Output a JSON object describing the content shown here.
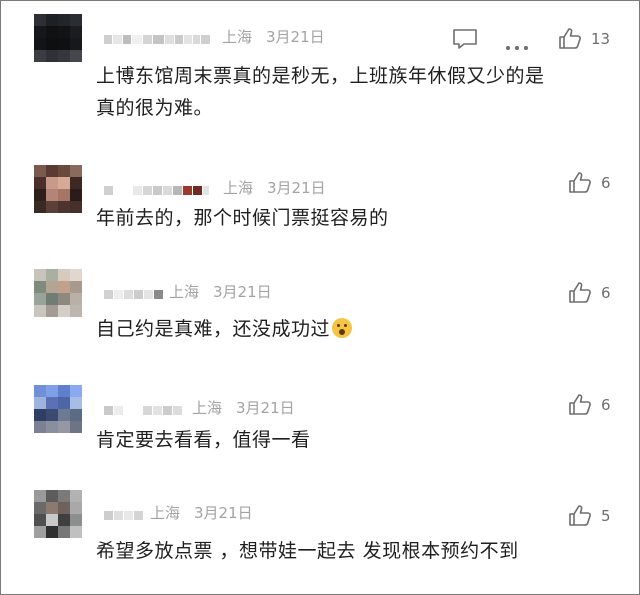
{
  "comments": [
    {
      "location": "上海",
      "date": "3月21日",
      "text_lines": [
        "上博东馆周末票真的是秒无，上班族年休假又少的是",
        "真的很为难。"
      ],
      "likes": "13",
      "show_actions": true
    },
    {
      "location": "上海",
      "date": "3月21日",
      "text_lines": [
        "年前去的，那个时候门票挺容易的"
      ],
      "likes": "6",
      "show_actions": false
    },
    {
      "location": "上海",
      "date": "3月21日",
      "text_lines": [
        "自己约是真难，还没成功过"
      ],
      "likes": "6",
      "show_actions": false
    },
    {
      "location": "上海",
      "date": "3月21日",
      "text_lines": [
        "肯定要去看看，值得一看"
      ],
      "likes": "6",
      "show_actions": false
    },
    {
      "location": "上海",
      "date": "3月21日",
      "text_lines": [
        "希望多放点票 ，想带娃一起去 发现根本预约不到"
      ],
      "likes": "5",
      "show_actions": false
    }
  ],
  "icons": {
    "reply": "comment-bubble-icon",
    "more": "more-dots-icon",
    "like": "thumbs-up-icon",
    "emoji": "crying-face-emoji"
  },
  "colors": {
    "meta": "#a3a3a3",
    "text": "#1f1f1f",
    "icon": "#6e6e6e"
  }
}
